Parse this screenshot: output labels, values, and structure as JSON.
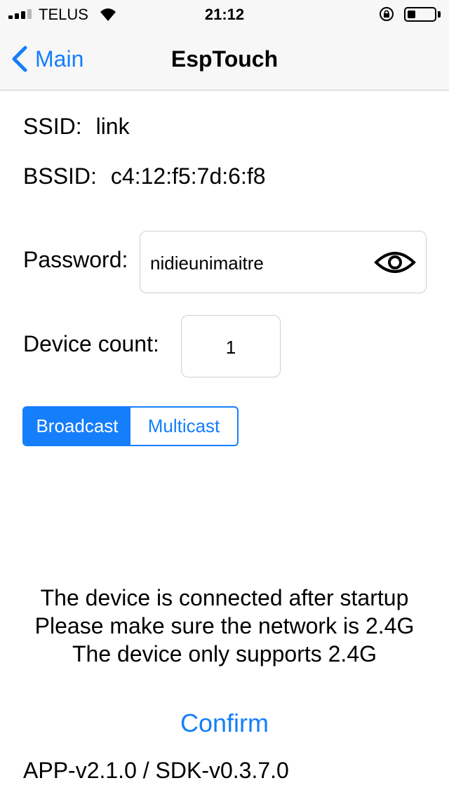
{
  "status_bar": {
    "carrier": "TELUS",
    "time": "21:12",
    "battery_level": 0.3,
    "icons": [
      "signal-icon",
      "wifi-icon",
      "rotation-lock-icon",
      "battery-icon"
    ]
  },
  "nav": {
    "back_label": "Main",
    "title": "EspTouch",
    "accent_color": "#157efb"
  },
  "wifi": {
    "ssid_label": "SSID:",
    "ssid_value": "link",
    "bssid_label": "BSSID:",
    "bssid_value": "c4:12:f5:7d:6:f8"
  },
  "password": {
    "label": "Password:",
    "value": "nidieunimaitre",
    "toggle_icon": "eye-icon"
  },
  "device_count": {
    "label": "Device count:",
    "value": "1"
  },
  "mode": {
    "options": [
      "Broadcast",
      "Multicast"
    ],
    "selected": "Broadcast"
  },
  "notes": {
    "line1": "The device is connected after startup",
    "line2": "Please make sure the network is 2.4G",
    "line3": "The device only supports 2.4G"
  },
  "actions": {
    "confirm_label": "Confirm"
  },
  "footer": {
    "version": "APP-v2.1.0 / SDK-v0.3.7.0"
  }
}
